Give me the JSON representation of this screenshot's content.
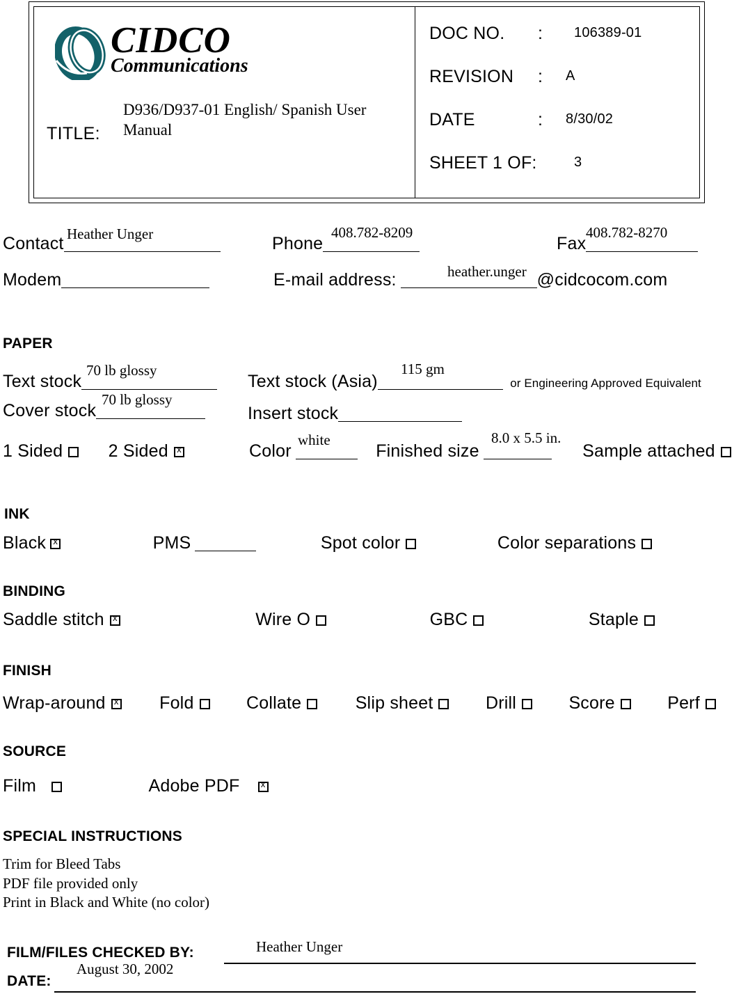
{
  "header": {
    "logo": {
      "mark_color": "#136169",
      "word1": "CIDCO",
      "word2": "Communications"
    },
    "title_label": "TITLE:",
    "title_value": "D936/D937-01 English/ Spanish User Manual",
    "fields": [
      {
        "key": "DOC NO.",
        "colon": ":",
        "value": "106389-01"
      },
      {
        "key": "REVISION",
        "colon": ":",
        "value": "A"
      },
      {
        "key": "DATE",
        "colon": ":",
        "value": "8/30/02"
      },
      {
        "key": "SHEET 1 OF:",
        "colon": "",
        "value": "3"
      }
    ]
  },
  "contact": {
    "contact_label": "Contact",
    "contact_value": "Heather Unger",
    "phone_label": "Phone",
    "phone_value": "408.782-8209",
    "fax_label": "Fax",
    "fax_value": "408.782-8270",
    "modem_label": "Modem",
    "modem_value": "",
    "email_label": "E-mail address:",
    "email_value": "heather.unger",
    "email_domain": "@cidcocom.com"
  },
  "paper": {
    "heading": "PAPER",
    "text_stock_label": "Text stock",
    "text_stock_value": "70 lb glossy",
    "text_stock_asia_label": "Text stock (Asia)",
    "text_stock_asia_value": "115 gm",
    "equivalent_note": "or Engineering Approved Equivalent",
    "cover_stock_label": "Cover stock",
    "cover_stock_value": "70 lb glossy",
    "insert_stock_label": "Insert stock",
    "insert_stock_value": "",
    "one_sided_label": "1 Sided",
    "one_sided_checked": false,
    "two_sided_label": "2 Sided",
    "two_sided_checked": true,
    "color_label": "Color",
    "color_value": "white",
    "finished_size_label": "Finished size",
    "finished_size_value": "8.0 x 5.5 in.",
    "sample_attached_label": "Sample attached",
    "sample_attached_checked": false
  },
  "ink": {
    "heading": "INK",
    "black_label": "Black",
    "black_checked": true,
    "pms_label": "PMS",
    "pms_value": "",
    "spot_color_label": "Spot color",
    "spot_color_checked": false,
    "color_separations_label": "Color separations",
    "color_separations_checked": false
  },
  "binding": {
    "heading": "BINDING",
    "items": [
      {
        "label": "Saddle stitch",
        "checked": true
      },
      {
        "label": "Wire O",
        "checked": false
      },
      {
        "label": "GBC",
        "checked": false
      },
      {
        "label": "Staple",
        "checked": false
      }
    ]
  },
  "finish": {
    "heading": "FINISH",
    "items": [
      {
        "label": "Wrap-around",
        "checked": true
      },
      {
        "label": "Fold",
        "checked": false
      },
      {
        "label": "Collate",
        "checked": false
      },
      {
        "label": "Slip sheet",
        "checked": false
      },
      {
        "label": "Drill",
        "checked": false
      },
      {
        "label": "Score",
        "checked": false
      },
      {
        "label": "Perf",
        "checked": false
      }
    ]
  },
  "source": {
    "heading": "SOURCE",
    "items": [
      {
        "label": "Film",
        "checked": false
      },
      {
        "label": "Adobe PDF",
        "checked": true
      }
    ]
  },
  "special_instructions": {
    "heading": "SPECIAL INSTRUCTIONS",
    "lines": "Trim for Bleed Tabs\nPDF file provided only\nPrint in Black and White (no color)"
  },
  "signoff": {
    "checked_by_label": "FILM/FILES CHECKED BY:",
    "checked_by_value": "Heather Unger",
    "date_label": "DATE:",
    "date_value": "August 30, 2002"
  }
}
